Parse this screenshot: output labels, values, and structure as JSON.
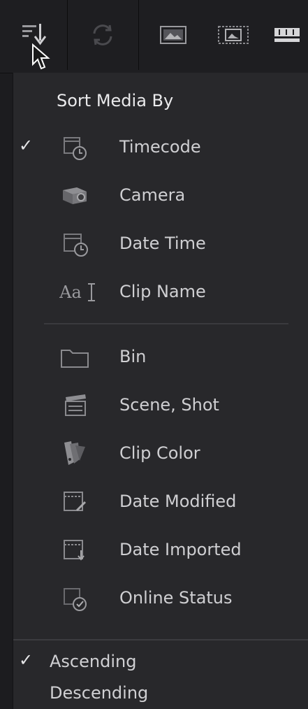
{
  "toolbar": {
    "buttons": [
      {
        "name": "sort-icon"
      },
      {
        "name": "sync-icon"
      },
      {
        "name": "thumbnail-view-icon"
      },
      {
        "name": "filmstrip-view-icon"
      },
      {
        "name": "timeline-view-icon"
      }
    ]
  },
  "menu": {
    "title": "Sort Media By",
    "sort_items": [
      {
        "label": "Timecode",
        "checked": true,
        "icon": "timecode-icon"
      },
      {
        "label": "Camera",
        "checked": false,
        "icon": "camera-icon"
      },
      {
        "label": "Date Time",
        "checked": false,
        "icon": "date-time-icon"
      },
      {
        "label": "Clip Name",
        "checked": false,
        "icon": "clip-name-icon",
        "icon_text": "Aa"
      },
      {
        "label": "Bin",
        "checked": false,
        "icon": "bin-folder-icon"
      },
      {
        "label": "Scene, Shot",
        "checked": false,
        "icon": "clapperboard-icon"
      },
      {
        "label": "Clip Color",
        "checked": false,
        "icon": "color-swatch-icon"
      },
      {
        "label": "Date Modified",
        "checked": false,
        "icon": "date-modified-icon"
      },
      {
        "label": "Date Imported",
        "checked": false,
        "icon": "date-imported-icon"
      },
      {
        "label": "Online Status",
        "checked": false,
        "icon": "online-status-icon"
      }
    ],
    "order_items": [
      {
        "label": "Ascending",
        "checked": true
      },
      {
        "label": "Descending",
        "checked": false
      }
    ],
    "check_glyph": "✓"
  }
}
